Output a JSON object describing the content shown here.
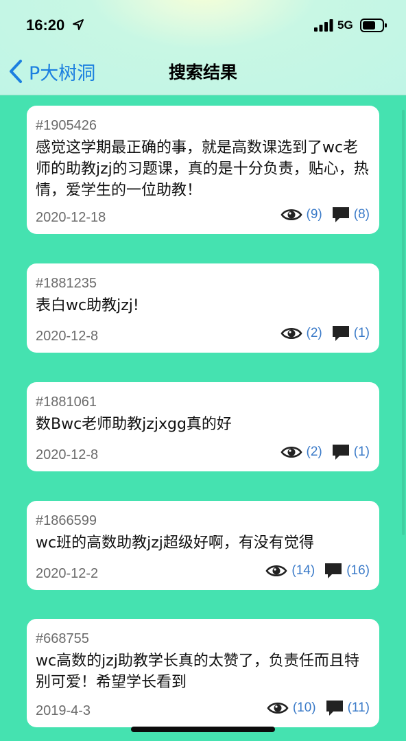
{
  "status_bar": {
    "time": "16:20",
    "network": "5G"
  },
  "nav": {
    "back_label": "P大树洞",
    "title": "搜索结果"
  },
  "posts": [
    {
      "id": "#1905426",
      "text": "感觉这学期最正确的事，就是高数课选到了wc老师的助教jzj的习题课，真的是十分负责，贴心，热情，爱学生的一位助教！",
      "date": "2020-12-18",
      "views": "(9)",
      "comments": "(8)"
    },
    {
      "id": "#1881235",
      "text": "表白wc助教jzj!",
      "date": "2020-12-8",
      "views": "(2)",
      "comments": "(1)"
    },
    {
      "id": "#1881061",
      "text": "数Bwc老师助教jzjxgg真的好",
      "date": "2020-12-8",
      "views": "(2)",
      "comments": "(1)"
    },
    {
      "id": "#1866599",
      "text": "wc班的高数助教jzj超级好啊，有没有觉得",
      "date": "2020-12-2",
      "views": "(14)",
      "comments": "(16)"
    },
    {
      "id": "#668755",
      "text": "wc高数的jzj助教学长真的太赞了，负责任而且特别可爱！希望学长看到",
      "date": "2019-4-3",
      "views": "(10)",
      "comments": "(11)"
    }
  ],
  "icons": {
    "location": "location-arrow-icon",
    "signal": "signal-bars-icon",
    "battery": "battery-icon",
    "back": "chevron-left-icon",
    "views": "eye-icon",
    "comments": "comment-bubble-icon"
  },
  "colors": {
    "background": "#45e2b0",
    "header": "#c0f5e6",
    "accent": "#1b7fe0",
    "count": "#3a7ac8"
  }
}
